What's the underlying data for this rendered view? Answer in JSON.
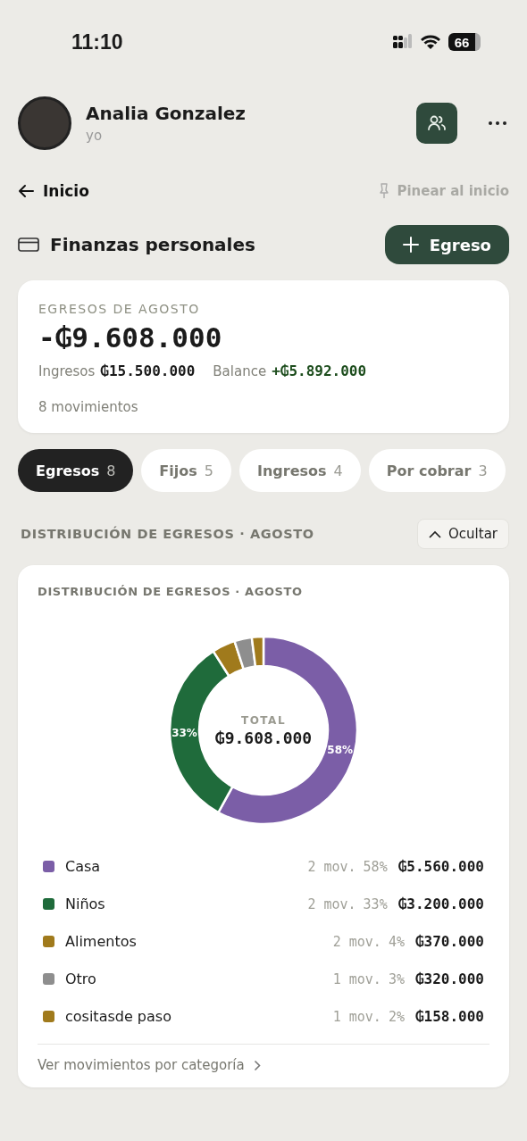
{
  "status_bar": {
    "time": "11:10",
    "battery": "66"
  },
  "profile": {
    "name": "Analia Gonzalez",
    "subtitle": "yo"
  },
  "nav": {
    "back": "Inicio",
    "pin": "Pinear al inicio"
  },
  "section": {
    "title": "Finanzas personales",
    "add_button": "Egreso"
  },
  "summary": {
    "label": "EGRESOS DE AGOSTO",
    "total": "-₲9.608.000",
    "income_label": "Ingresos",
    "income": "₲15.500.000",
    "balance_label": "Balance",
    "balance": "+₲5.892.000",
    "movements": "8 movimientos"
  },
  "tabs": [
    {
      "label": "Egresos",
      "count": "8",
      "selected": true
    },
    {
      "label": "Fijos",
      "count": "5",
      "selected": false
    },
    {
      "label": "Ingresos",
      "count": "4",
      "selected": false
    },
    {
      "label": "Por cobrar",
      "count": "3",
      "selected": false
    }
  ],
  "distribution": {
    "heading": "DISTRIBUCIÓN DE EGRESOS · AGOSTO",
    "toggle": "Ocultar",
    "expanded": true,
    "card_title": "DISTRIBUCIÓN DE EGRESOS · AGOSTO",
    "center_label": "TOTAL",
    "center_value": "₲9.608.000",
    "chart_data": {
      "type": "donut",
      "values": [
        58,
        33,
        4,
        3,
        2
      ],
      "value_labels": [
        "58%",
        "33%",
        null,
        null,
        null
      ]
    },
    "legend": [
      {
        "name": "Casa",
        "count": "2 mov.",
        "percent": "58%",
        "amount": "₲5.560.000",
        "color": "#7b5ea7"
      },
      {
        "name": "Niños",
        "count": "2 mov.",
        "percent": "33%",
        "amount": "₲3.200.000",
        "color": "#1f6b3b"
      },
      {
        "name": "Alimentos",
        "count": "2 mov.",
        "percent": "4%",
        "amount": "₲370.000",
        "color": "#a07a1c"
      },
      {
        "name": "Otro",
        "count": "1 mov.",
        "percent": "3%",
        "amount": "₲320.000",
        "color": "#8e8e8e"
      },
      {
        "name": "cositasde paso",
        "count": "1 mov.",
        "percent": "2%",
        "amount": "₲158.000",
        "color": "#a07a1c"
      }
    ],
    "footer_link": "Ver movimientos por categoría"
  }
}
